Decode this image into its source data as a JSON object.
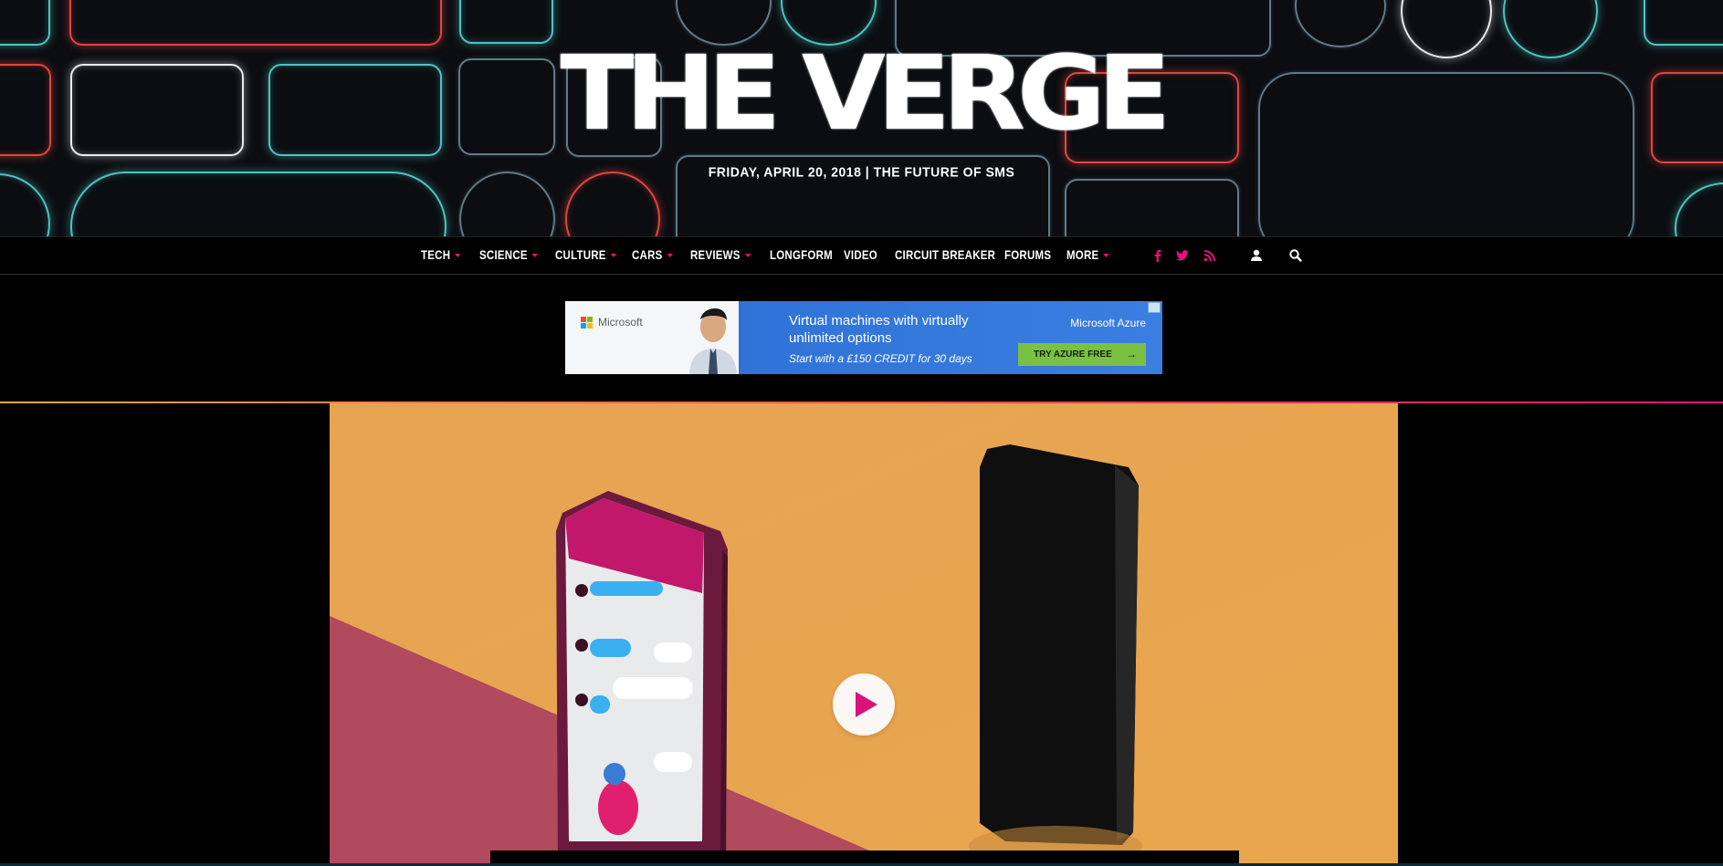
{
  "site": {
    "logo_text": "THE VERGE",
    "dateline": "FRIDAY, APRIL 20, 2018 | THE FUTURE OF SMS"
  },
  "nav": {
    "items": [
      {
        "label": "TECH",
        "has_dropdown": true
      },
      {
        "label": "SCIENCE",
        "has_dropdown": true
      },
      {
        "label": "CULTURE",
        "has_dropdown": true
      },
      {
        "label": "CARS",
        "has_dropdown": true
      },
      {
        "label": "REVIEWS",
        "has_dropdown": true
      },
      {
        "label": "LONGFORM",
        "has_dropdown": false
      },
      {
        "label": "VIDEO",
        "has_dropdown": false
      },
      {
        "label": "CIRCUIT BREAKER",
        "has_dropdown": false
      },
      {
        "label": "FORUMS",
        "has_dropdown": false
      },
      {
        "label": "MORE",
        "has_dropdown": true
      }
    ],
    "social_icons": [
      "facebook-icon",
      "twitter-icon",
      "rss-icon"
    ],
    "utility_icons": [
      "user-icon",
      "search-icon"
    ],
    "accent_color": "#e2127a"
  },
  "ad": {
    "brand": "Microsoft",
    "headline": "Virtual machines with virtually unlimited options",
    "subline": "Start with a £150 CREDIT for 30 days",
    "product": "Microsoft Azure",
    "cta": "TRY AZURE FREE",
    "cta_arrow": "→"
  },
  "hero": {
    "type": "video",
    "play_icon": "play-icon",
    "background_color": "#eaa650"
  }
}
